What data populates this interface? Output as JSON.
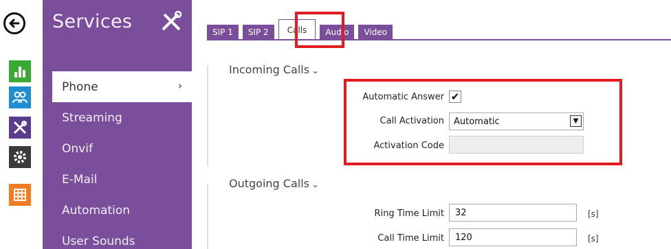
{
  "rail": {
    "back_icon": "back-arrow-icon",
    "items": [
      {
        "icon": "status-chart-icon",
        "color": "#3aaa35"
      },
      {
        "icon": "directory-users-icon",
        "color": "#1e8ed0"
      },
      {
        "icon": "services-tools-icon",
        "color": "#5b3c8c"
      },
      {
        "icon": "system-gear-icon",
        "color": "#3b3b3b"
      },
      {
        "icon": "apps-grid-icon",
        "color": "#f47c20"
      }
    ]
  },
  "services": {
    "title": "Services",
    "menu": [
      {
        "label": "Phone",
        "active": true,
        "chevron": "›"
      },
      {
        "label": "Streaming"
      },
      {
        "label": "Onvif"
      },
      {
        "label": "E-Mail"
      },
      {
        "label": "Automation"
      },
      {
        "label": "User Sounds"
      }
    ]
  },
  "tabs": [
    "SIP 1",
    "SIP 2",
    "Calls",
    "Audio",
    "Video"
  ],
  "active_tab": "Calls",
  "incoming": {
    "title": "Incoming Calls",
    "caret": "⌄",
    "automatic_answer_label": "Automatic Answer",
    "automatic_answer_checked": "✔",
    "call_activation_label": "Call Activation",
    "call_activation_value": "Automatic",
    "activation_code_label": "Activation Code",
    "activation_code_value": ""
  },
  "outgoing": {
    "title": "Outgoing Calls",
    "caret": "⌄",
    "ring_time_label": "Ring Time Limit",
    "ring_time_value": "32",
    "ring_time_unit": "[s]",
    "call_time_label": "Call Time Limit",
    "call_time_value": "120",
    "call_time_unit": "[s]"
  },
  "colors": {
    "brand_purple": "#7a4e9a",
    "highlight_red": "#e11b22"
  }
}
